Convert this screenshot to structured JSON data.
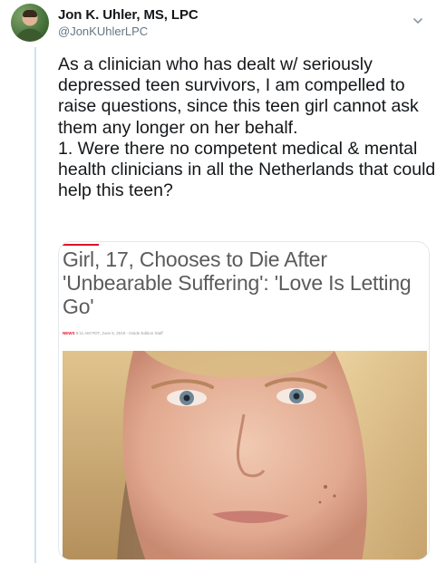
{
  "tweet": {
    "author_name": "Jon K. Uhler, MS, LPC",
    "author_handle": "@JonKUhlerLPC",
    "paragraph_1": "As a clinician who has dealt w/ seriously depressed teen survivors, I am compelled to raise questions, since this teen girl cannot ask them any longer on her behalf.",
    "paragraph_2": "1. Were there no competent medical & mental health clinicians in all the Netherlands that could help this teen?"
  },
  "card": {
    "title": "Girl, 17, Chooses to Die After 'Unbearable Suffering': 'Love Is Letting Go'",
    "category": "NEWS",
    "meta": "9:11 AM PDT, June 5, 2019 - Inside Edition Staff"
  },
  "icons": {
    "caret": "chevron-down-icon",
    "avatar": "profile-photo"
  },
  "colors": {
    "thread_line": "#cce3f4",
    "handle_gray": "#657786",
    "news_red": "#e0112b"
  }
}
